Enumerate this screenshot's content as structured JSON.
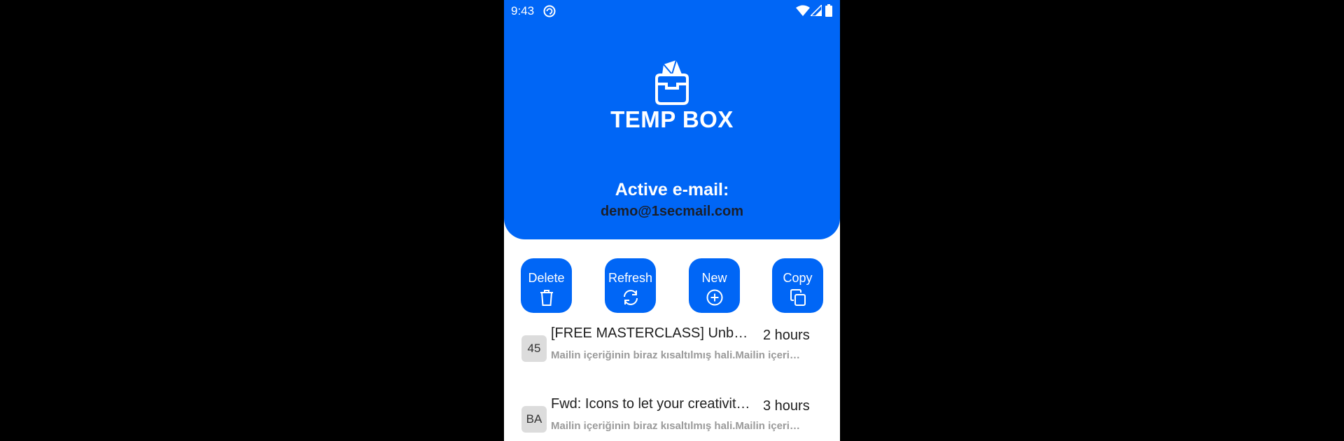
{
  "status_bar": {
    "time": "9:43"
  },
  "app": {
    "name": "TEMP BOX",
    "brand_color": "#0066f6"
  },
  "active": {
    "label": "Active e-mail:",
    "email": "demo@1secmail.com"
  },
  "actions": [
    {
      "label": "Delete",
      "icon": "trash-icon"
    },
    {
      "label": "Refresh",
      "icon": "refresh-icon"
    },
    {
      "label": "New",
      "icon": "plus-circle-icon"
    },
    {
      "label": "Copy",
      "icon": "copy-icon"
    }
  ],
  "mails": [
    {
      "avatar": "45",
      "subject": "[FREE MASTERCLASS] Unbeatable Tips to",
      "time": "2 hours",
      "preview": "Mailin içeriğinin biraz kısaltılmış hali.Mailin içeriğinin biraz kısaltılmış hali."
    },
    {
      "avatar": "BA",
      "subject": "Fwd: Icons to let your creativity shine",
      "time": "3 hours",
      "preview": "Mailin içeriğinin biraz kısaltılmış hali.Mailin içeriğinin biraz kısaltılmış hali."
    }
  ]
}
